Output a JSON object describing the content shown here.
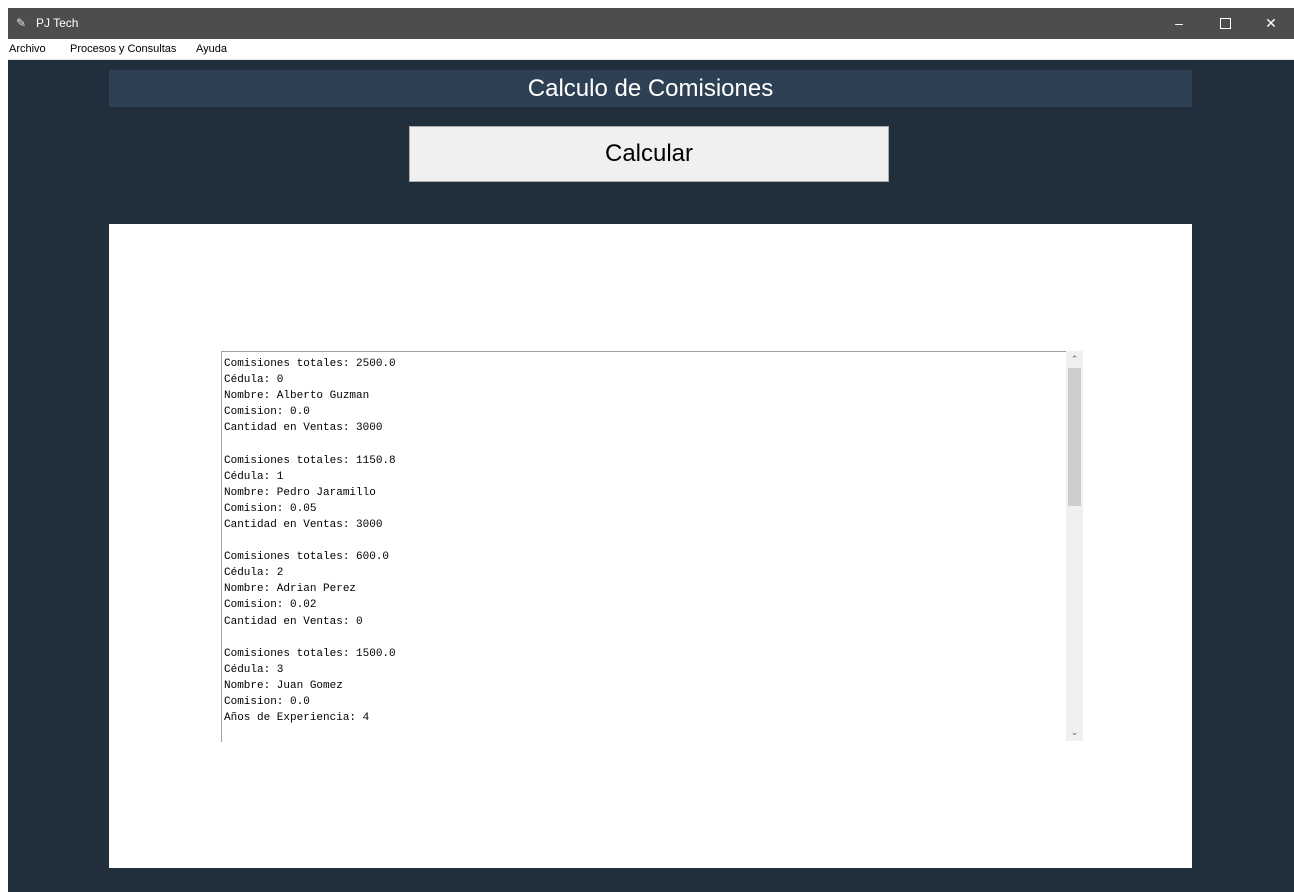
{
  "window": {
    "title": "PJ Tech",
    "controls": {
      "minimize": "–",
      "close": "✕"
    }
  },
  "menu": {
    "items": [
      {
        "label": "Archivo"
      },
      {
        "label": "Procesos y Consultas"
      },
      {
        "label": "Ayuda"
      }
    ]
  },
  "header": {
    "title": "Calculo de Comisiones"
  },
  "actions": {
    "calculate_label": "Calcular"
  },
  "results": {
    "text": "Comisiones totales: 2500.0\nCédula: 0\nNombre: Alberto Guzman\nComision: 0.0\nCantidad en Ventas: 3000\n\nComisiones totales: 1150.8\nCédula: 1\nNombre: Pedro Jaramillo\nComision: 0.05\nCantidad en Ventas: 3000\n\nComisiones totales: 600.0\nCédula: 2\nNombre: Adrian Perez\nComision: 0.02\nCantidad en Ventas: 0\n\nComisiones totales: 1500.0\nCédula: 3\nNombre: Juan Gomez\nComision: 0.0\nAños de Experiencia: 4"
  },
  "colors": {
    "background": "#212f3c",
    "banner": "#2e4053",
    "titlebar": "#4d4d4d"
  },
  "icons": {
    "app": "feather-icon",
    "scroll_up": "chevron-up-icon",
    "scroll_down": "chevron-down-icon"
  }
}
